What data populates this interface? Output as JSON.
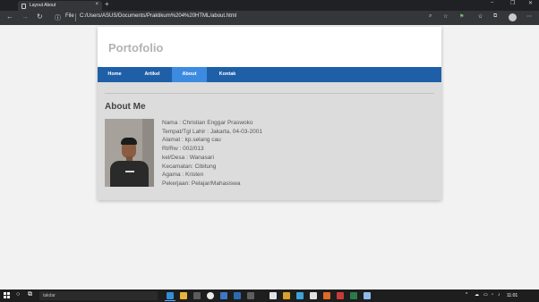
{
  "browser": {
    "tab_title": "Layout About",
    "tab_close": "×",
    "new_tab": "+",
    "window_controls": [
      "–",
      "❐",
      "✕"
    ],
    "nav_icons": [
      "back-icon",
      "forward-icon",
      "reload-icon"
    ],
    "nav_glyphs": [
      "←",
      "→",
      "↻"
    ],
    "info_glyph": "ⓘ",
    "address_scheme": "File",
    "address_url": "C:/Users/ASUS/Documents/Praktikum%204%20HTML/about.html",
    "toolbar_glyphs": [
      "⌕",
      "☆",
      "⚑",
      "✩",
      "⧉"
    ],
    "menu_glyph": "⋯"
  },
  "site": {
    "title": "Portofolio",
    "nav": [
      {
        "label": "Home",
        "active": false
      },
      {
        "label": "Artikel",
        "active": false
      },
      {
        "label": "About",
        "active": true
      },
      {
        "label": "Kontak",
        "active": false
      }
    ],
    "section_title": "About Me",
    "bio": [
      "Nama : Christian Enggar Praswoko",
      "Tempat/Tgl Lahir : Jakarta, 04-03-2001",
      "Alamat : kp.selang cau",
      "Rt/Rw : 002/013",
      "kel/Desa : Wanasari",
      "Kecamatan: Cibitung",
      "Agama : Kristen",
      "Pekerjaan: Pelajar/Mahasiswa"
    ],
    "colors": {
      "nav_bg": "#1f5fa8",
      "nav_active": "#3d8be0",
      "page_bg": "#dcdcdc"
    }
  },
  "taskbar": {
    "search_placeholder": "takdar",
    "icons_glyphs": [
      "○",
      "⧉"
    ],
    "tray_glyphs": [
      "^",
      "☁",
      "▭",
      "◔",
      "♪"
    ],
    "clock": "11:01"
  }
}
